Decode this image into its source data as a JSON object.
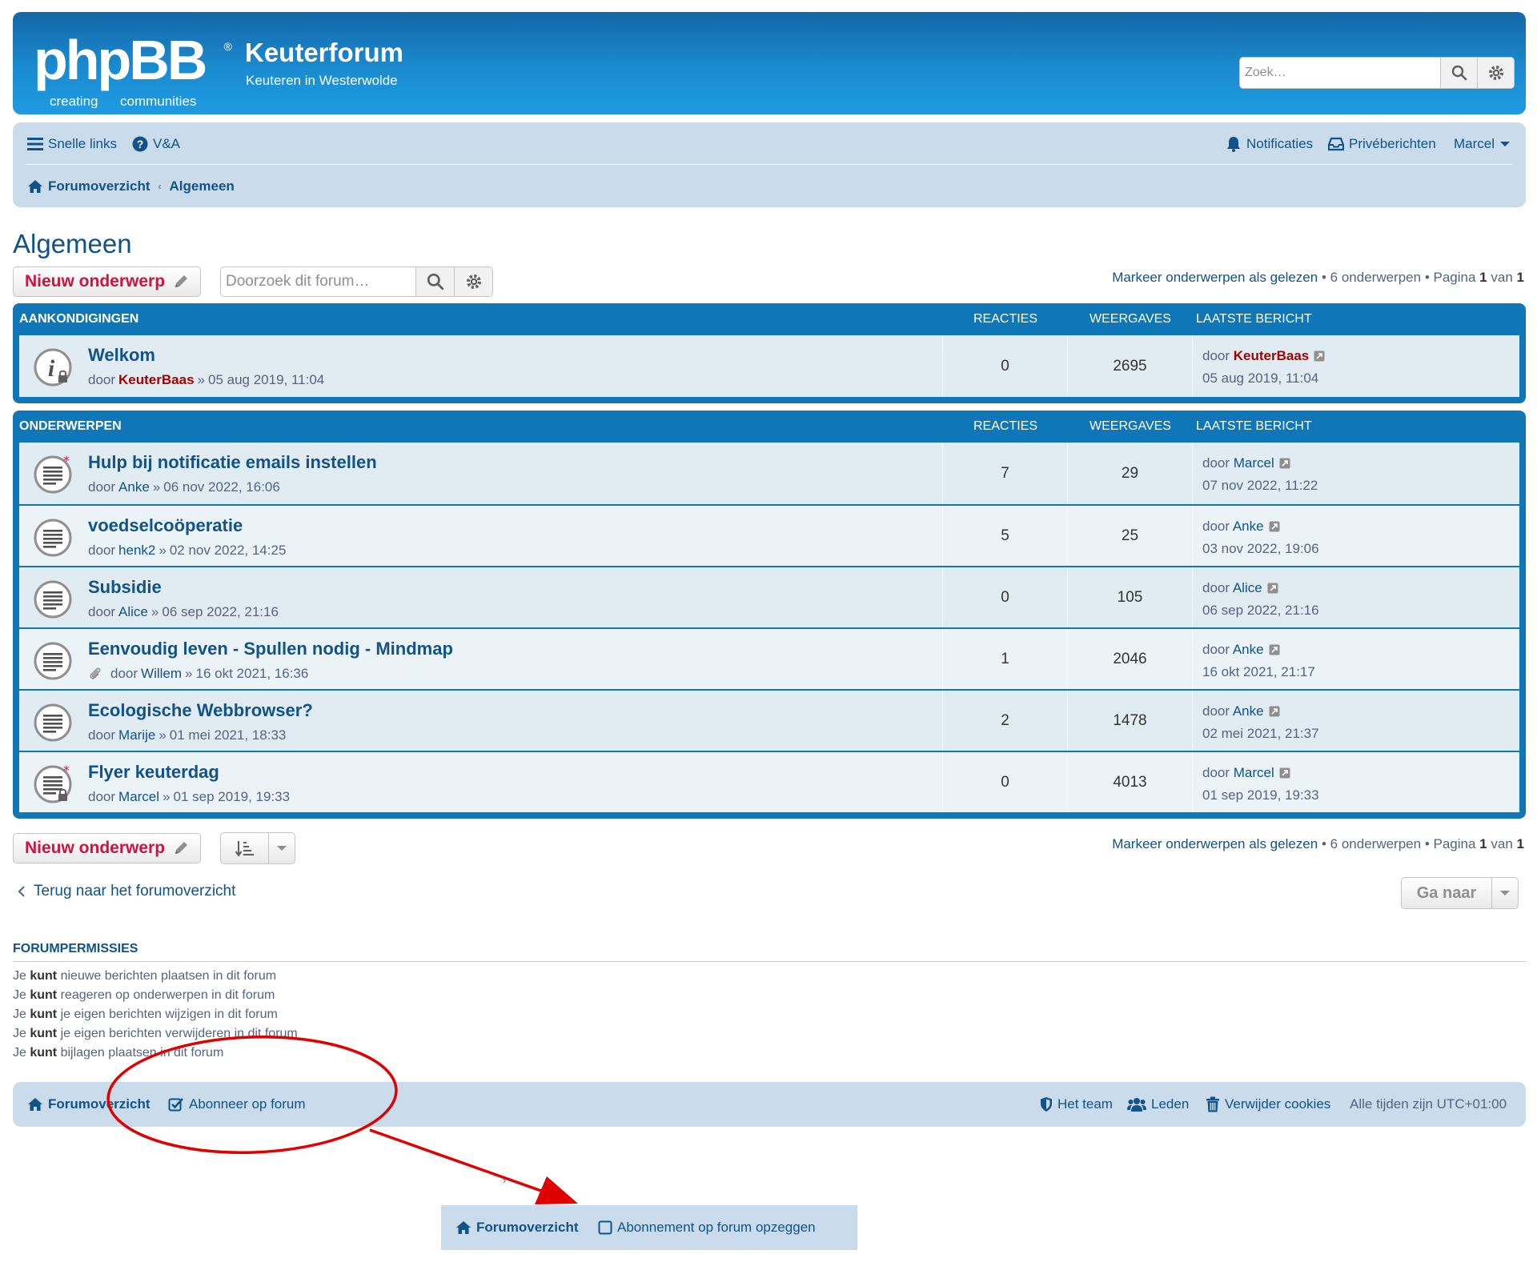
{
  "header": {
    "logo_main": "phpBB",
    "logo_tagline_left": "creating",
    "logo_tagline_right": "communities",
    "site_title": "Keuterforum",
    "site_desc": "Keuteren in Westerwolde",
    "search_placeholder": "Zoek…"
  },
  "navbar": {
    "quick_links": "Snelle links",
    "faq": "V&A",
    "notifications": "Notificaties",
    "messages": "Privéberichten",
    "user": "Marcel",
    "crumb_home": "Forumoverzicht",
    "crumb_forum": "Algemeen"
  },
  "page": {
    "title": "Algemeen",
    "new_topic": "Nieuw onderwerp",
    "forum_search_placeholder": "Doorzoek dit forum…",
    "mark_read": "Markeer onderwerpen als gelezen",
    "topic_count": "6 onderwerpen",
    "page_label": "Pagina",
    "page_current": "1",
    "page_of": "van",
    "page_total": "1"
  },
  "columns": {
    "announcements": "AANKONDIGINGEN",
    "topics": "ONDERWERPEN",
    "replies": "REACTIES",
    "views": "WEERGAVES",
    "last_post": "LAATSTE BERICHT"
  },
  "by_label": "door",
  "announcements": [
    {
      "title": "Welkom",
      "author": "KeuterBaas",
      "date": "05 aug 2019, 11:04",
      "replies": "0",
      "views": "2695",
      "last_author": "KeuterBaas",
      "last_date": "05 aug 2019, 11:04"
    }
  ],
  "topics": [
    {
      "title": "Hulp bij notificatie emails instellen",
      "author": "Anke",
      "date": "06 nov 2022, 16:06",
      "replies": "7",
      "views": "29",
      "last_author": "Marcel",
      "last_date": "07 nov 2022, 11:22"
    },
    {
      "title": "voedselcoöperatie",
      "author": "henk2",
      "date": "02 nov 2022, 14:25",
      "replies": "5",
      "views": "25",
      "last_author": "Anke",
      "last_date": "03 nov 2022, 19:06"
    },
    {
      "title": "Subsidie",
      "author": "Alice",
      "date": "06 sep 2022, 21:16",
      "replies": "0",
      "views": "105",
      "last_author": "Alice",
      "last_date": "06 sep 2022, 21:16"
    },
    {
      "title": "Eenvoudig leven - Spullen nodig - Mindmap",
      "author": "Willem",
      "date": "16 okt 2021, 16:36",
      "replies": "1",
      "views": "2046",
      "last_author": "Anke",
      "last_date": "16 okt 2021, 21:17"
    },
    {
      "title": "Ecologische Webbrowser?",
      "author": "Marije",
      "date": "01 mei 2021, 18:33",
      "replies": "2",
      "views": "1478",
      "last_author": "Anke",
      "last_date": "02 mei 2021, 21:37"
    },
    {
      "title": "Flyer keuterdag",
      "author": "Marcel",
      "date": "01 sep 2019, 19:33",
      "replies": "0",
      "views": "4013",
      "last_author": "Marcel",
      "last_date": "01 sep 2019, 19:33"
    }
  ],
  "bottom": {
    "back_link": "Terug naar het forumoverzicht",
    "jump_to": "Ga naar"
  },
  "permissions": {
    "title": "FORUMPERMISSIES",
    "prefix": "Je",
    "can": "kunt",
    "items": [
      "nieuwe berichten plaatsen in dit forum",
      "reageren op onderwerpen in dit forum",
      "je eigen berichten wijzigen in dit forum",
      "je eigen berichten verwijderen in dit forum",
      "bijlagen plaatsen in dit forum"
    ]
  },
  "footer": {
    "home": "Forumoverzicht",
    "subscribe": "Abonneer op forum",
    "team": "Het team",
    "members": "Leden",
    "delete_cookies": "Verwijder cookies",
    "timezone": "Alle tijden zijn UTC+01:00"
  },
  "detail": {
    "home": "Forumoverzicht",
    "unsubscribe": "Abonnement op forum opzeggen"
  },
  "colors": {
    "header_blue": "#1b8bd0",
    "navbar_bg": "#cadceb",
    "link_blue": "#105289",
    "new_topic_red": "#d31141",
    "admin_red": "#aa0000",
    "annotation_red": "#e00000"
  }
}
